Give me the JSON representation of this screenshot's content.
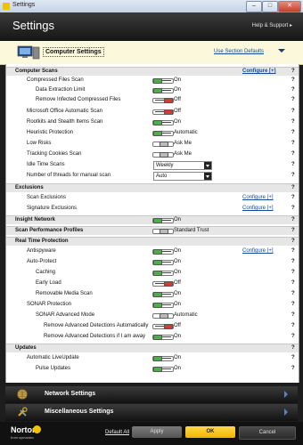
{
  "window": {
    "title": "Settings"
  },
  "header": {
    "title": "Settings",
    "help": "Help & Support ▸"
  },
  "section_bar": {
    "label": "Computer Settings",
    "use_defaults": "Use Section Defaults"
  },
  "configure": "Configure [+]",
  "help_mark": "?",
  "states": {
    "on": "On",
    "off": "Off",
    "ask": "Ask Me"
  },
  "rows": {
    "computer_scans": "Computer Scans",
    "compressed": "Compressed Files Scan",
    "data_extraction": "Data Extraction Limit",
    "remove_infected": "Remove Infected Compressed Files",
    "ms_office": "Microsoft Office Automatic Scan",
    "rootkits": "Rootkits and Stealth Items Scan",
    "heuristic": "Heuristic Protection",
    "heuristic_val": "Automatic",
    "low_risks": "Low Risks",
    "tracking": "Tracking Cookies Scan",
    "idle": "Idle Time Scans",
    "idle_val": "Weekly",
    "threads": "Number of threads for manual scan",
    "threads_val": "Auto",
    "exclusions": "Exclusions",
    "scan_excl": "Scan Exclusions",
    "sig_excl": "Signature Exclusions",
    "insight": "Insight Network",
    "perf": "Scan Performance Profiles",
    "perf_val": "Standard Trust",
    "rtp": "Real Time Protection",
    "antispyware": "Antispyware",
    "autoprotect": "Auto-Protect",
    "caching": "Caching",
    "early": "Early Load",
    "removable": "Removable Media Scan",
    "sonar": "SONAR Protection",
    "sonar_adv": "SONAR Advanced Mode",
    "sonar_adv_val": "Automatic",
    "remove_auto": "Remove Advanced Detections Automatically",
    "remove_away": "Remove Advanced Detections if I am away",
    "updates": "Updates",
    "liveupdate": "Automatic LiveUpdate",
    "pulse": "Pulse Updates"
  },
  "bottom": {
    "network": "Network Settings",
    "misc": "Miscellaneous Settings"
  },
  "footer": {
    "logo": "Norton",
    "logo_sub": "from symantec",
    "default_all": "Default All",
    "apply": "Apply",
    "ok": "OK",
    "cancel": "Cancel"
  }
}
